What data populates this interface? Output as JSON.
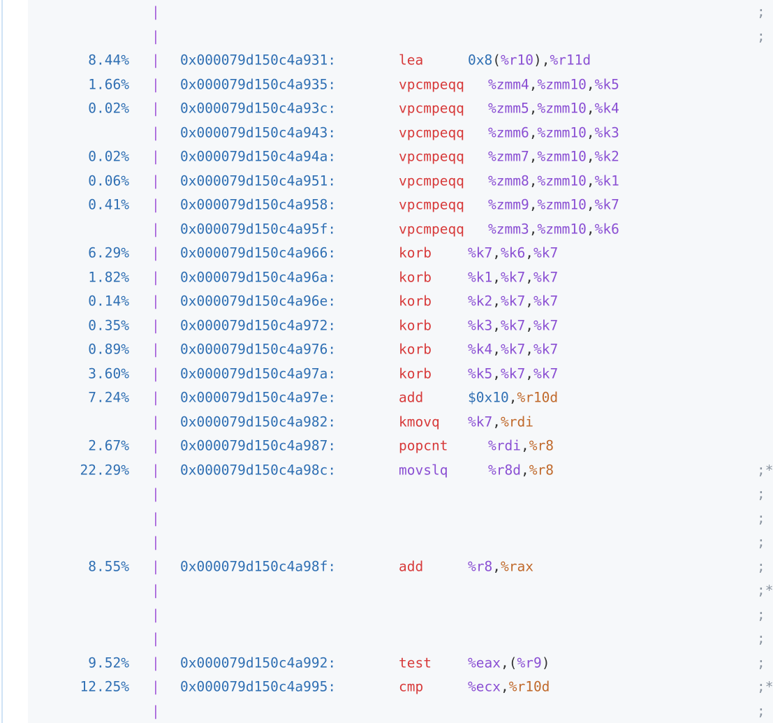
{
  "rows": [
    {
      "pct": "",
      "addr": "",
      "mnem": "",
      "ops": [],
      "semi": ";"
    },
    {
      "pct": "",
      "addr": "",
      "mnem": "",
      "ops": [],
      "semi": ";"
    },
    {
      "pct": "8.44%",
      "addr": "0x000079d150c4a931:",
      "mnem": "lea",
      "ops": [
        {
          "t": "0x8",
          "c": "num"
        },
        {
          "t": "(",
          "c": "punc"
        },
        {
          "t": "%r10",
          "c": "reg"
        },
        {
          "t": "),",
          "c": "punc"
        },
        {
          "t": "%r11d",
          "c": "reg"
        }
      ],
      "semi": ""
    },
    {
      "pct": "1.66%",
      "addr": "0x000079d150c4a935:",
      "mnem": "vpcmpeqq",
      "ops": [
        {
          "t": "%zmm4",
          "c": "reg"
        },
        {
          "t": ",",
          "c": "punc"
        },
        {
          "t": "%zmm10",
          "c": "reg"
        },
        {
          "t": ",",
          "c": "punc"
        },
        {
          "t": "%k5",
          "c": "reg"
        }
      ],
      "semi": ""
    },
    {
      "pct": "0.02%",
      "addr": "0x000079d150c4a93c:",
      "mnem": "vpcmpeqq",
      "ops": [
        {
          "t": "%zmm5",
          "c": "reg"
        },
        {
          "t": ",",
          "c": "punc"
        },
        {
          "t": "%zmm10",
          "c": "reg"
        },
        {
          "t": ",",
          "c": "punc"
        },
        {
          "t": "%k4",
          "c": "reg"
        }
      ],
      "semi": ""
    },
    {
      "pct": "",
      "addr": "0x000079d150c4a943:",
      "mnem": "vpcmpeqq",
      "ops": [
        {
          "t": "%zmm6",
          "c": "reg"
        },
        {
          "t": ",",
          "c": "punc"
        },
        {
          "t": "%zmm10",
          "c": "reg"
        },
        {
          "t": ",",
          "c": "punc"
        },
        {
          "t": "%k3",
          "c": "reg"
        }
      ],
      "semi": ""
    },
    {
      "pct": "0.02%",
      "addr": "0x000079d150c4a94a:",
      "mnem": "vpcmpeqq",
      "ops": [
        {
          "t": "%zmm7",
          "c": "reg"
        },
        {
          "t": ",",
          "c": "punc"
        },
        {
          "t": "%zmm10",
          "c": "reg"
        },
        {
          "t": ",",
          "c": "punc"
        },
        {
          "t": "%k2",
          "c": "reg"
        }
      ],
      "semi": ""
    },
    {
      "pct": "0.06%",
      "addr": "0x000079d150c4a951:",
      "mnem": "vpcmpeqq",
      "ops": [
        {
          "t": "%zmm8",
          "c": "reg"
        },
        {
          "t": ",",
          "c": "punc"
        },
        {
          "t": "%zmm10",
          "c": "reg"
        },
        {
          "t": ",",
          "c": "punc"
        },
        {
          "t": "%k1",
          "c": "reg"
        }
      ],
      "semi": ""
    },
    {
      "pct": "0.41%",
      "addr": "0x000079d150c4a958:",
      "mnem": "vpcmpeqq",
      "ops": [
        {
          "t": "%zmm9",
          "c": "reg"
        },
        {
          "t": ",",
          "c": "punc"
        },
        {
          "t": "%zmm10",
          "c": "reg"
        },
        {
          "t": ",",
          "c": "punc"
        },
        {
          "t": "%k7",
          "c": "reg"
        }
      ],
      "semi": ""
    },
    {
      "pct": "",
      "addr": "0x000079d150c4a95f:",
      "mnem": "vpcmpeqq",
      "ops": [
        {
          "t": "%zmm3",
          "c": "reg"
        },
        {
          "t": ",",
          "c": "punc"
        },
        {
          "t": "%zmm10",
          "c": "reg"
        },
        {
          "t": ",",
          "c": "punc"
        },
        {
          "t": "%k6",
          "c": "reg"
        }
      ],
      "semi": ""
    },
    {
      "pct": "6.29%",
      "addr": "0x000079d150c4a966:",
      "mnem": "korb",
      "ops": [
        {
          "t": "%k7",
          "c": "reg"
        },
        {
          "t": ",",
          "c": "punc"
        },
        {
          "t": "%k6",
          "c": "reg"
        },
        {
          "t": ",",
          "c": "punc"
        },
        {
          "t": "%k7",
          "c": "reg"
        }
      ],
      "semi": ""
    },
    {
      "pct": "1.82%",
      "addr": "0x000079d150c4a96a:",
      "mnem": "korb",
      "ops": [
        {
          "t": "%k1",
          "c": "reg"
        },
        {
          "t": ",",
          "c": "punc"
        },
        {
          "t": "%k7",
          "c": "reg"
        },
        {
          "t": ",",
          "c": "punc"
        },
        {
          "t": "%k7",
          "c": "reg"
        }
      ],
      "semi": ""
    },
    {
      "pct": "0.14%",
      "addr": "0x000079d150c4a96e:",
      "mnem": "korb",
      "ops": [
        {
          "t": "%k2",
          "c": "reg"
        },
        {
          "t": ",",
          "c": "punc"
        },
        {
          "t": "%k7",
          "c": "reg"
        },
        {
          "t": ",",
          "c": "punc"
        },
        {
          "t": "%k7",
          "c": "reg"
        }
      ],
      "semi": ""
    },
    {
      "pct": "0.35%",
      "addr": "0x000079d150c4a972:",
      "mnem": "korb",
      "ops": [
        {
          "t": "%k3",
          "c": "reg"
        },
        {
          "t": ",",
          "c": "punc"
        },
        {
          "t": "%k7",
          "c": "reg"
        },
        {
          "t": ",",
          "c": "punc"
        },
        {
          "t": "%k7",
          "c": "reg"
        }
      ],
      "semi": ""
    },
    {
      "pct": "0.89%",
      "addr": "0x000079d150c4a976:",
      "mnem": "korb",
      "ops": [
        {
          "t": "%k4",
          "c": "reg"
        },
        {
          "t": ",",
          "c": "punc"
        },
        {
          "t": "%k7",
          "c": "reg"
        },
        {
          "t": ",",
          "c": "punc"
        },
        {
          "t": "%k7",
          "c": "reg"
        }
      ],
      "semi": ""
    },
    {
      "pct": "3.60%",
      "addr": "0x000079d150c4a97a:",
      "mnem": "korb",
      "ops": [
        {
          "t": "%k5",
          "c": "reg"
        },
        {
          "t": ",",
          "c": "punc"
        },
        {
          "t": "%k7",
          "c": "reg"
        },
        {
          "t": ",",
          "c": "punc"
        },
        {
          "t": "%k7",
          "c": "reg"
        }
      ],
      "semi": ""
    },
    {
      "pct": "7.24%",
      "addr": "0x000079d150c4a97e:",
      "mnem": "add",
      "ops": [
        {
          "t": "$0x10",
          "c": "num"
        },
        {
          "t": ",",
          "c": "punc"
        },
        {
          "t": "%r10d",
          "c": "brn"
        }
      ],
      "semi": ""
    },
    {
      "pct": "",
      "addr": "0x000079d150c4a982:",
      "mnem": "kmovq",
      "ops": [
        {
          "t": "%k7",
          "c": "reg"
        },
        {
          "t": ",",
          "c": "punc"
        },
        {
          "t": "%rdi",
          "c": "brn"
        }
      ],
      "semi": ""
    },
    {
      "pct": "2.67%",
      "addr": "0x000079d150c4a987:",
      "mnem": "popcnt",
      "ops": [
        {
          "t": "%rdi",
          "c": "reg"
        },
        {
          "t": ",",
          "c": "punc"
        },
        {
          "t": "%r8",
          "c": "brn"
        }
      ],
      "semi": ""
    },
    {
      "pct": "22.29%",
      "addr": "0x000079d150c4a98c:",
      "mnem": "movslq",
      "ops": [
        {
          "t": "%r8d",
          "c": "reg"
        },
        {
          "t": ",",
          "c": "punc"
        },
        {
          "t": "%r8",
          "c": "brn"
        }
      ],
      "semi": ";*",
      "alt": true
    },
    {
      "pct": "",
      "addr": "",
      "mnem": "",
      "ops": [],
      "semi": ";"
    },
    {
      "pct": "",
      "addr": "",
      "mnem": "",
      "ops": [],
      "semi": ";"
    },
    {
      "pct": "",
      "addr": "",
      "mnem": "",
      "ops": [],
      "semi": ";"
    },
    {
      "pct": "8.55%",
      "addr": "0x000079d150c4a98f:",
      "mnem": "add",
      "ops": [
        {
          "t": "%r8",
          "c": "reg"
        },
        {
          "t": ",",
          "c": "punc"
        },
        {
          "t": "%rax",
          "c": "brn"
        }
      ],
      "semi": ";"
    },
    {
      "pct": "",
      "addr": "",
      "mnem": "",
      "ops": [],
      "semi": ";*"
    },
    {
      "pct": "",
      "addr": "",
      "mnem": "",
      "ops": [],
      "semi": ";"
    },
    {
      "pct": "",
      "addr": "",
      "mnem": "",
      "ops": [],
      "semi": ";"
    },
    {
      "pct": "9.52%",
      "addr": "0x000079d150c4a992:",
      "mnem": "test",
      "ops": [
        {
          "t": "%eax",
          "c": "reg"
        },
        {
          "t": ",",
          "c": "punc"
        },
        {
          "t": "(",
          "c": "punc"
        },
        {
          "t": "%r9",
          "c": "reg"
        },
        {
          "t": ")",
          "c": "punc"
        }
      ],
      "semi": ";"
    },
    {
      "pct": "12.25%",
      "addr": "0x000079d150c4a995:",
      "mnem": "cmp",
      "ops": [
        {
          "t": "%ecx",
          "c": "reg"
        },
        {
          "t": ",",
          "c": "punc"
        },
        {
          "t": "%r10d",
          "c": "brn"
        }
      ],
      "semi": ";*"
    },
    {
      "pct": "",
      "addr": "",
      "mnem": "",
      "ops": [],
      "semi": ";"
    }
  ],
  "pipe_char": "|",
  "colors": {
    "percent": "#2f6fb3",
    "address": "#2f6fb3",
    "mnemonic": "#d73a3a",
    "register": "#8a4fd3",
    "gutter_pipe": "#a259d9",
    "background": "#f6f8fa"
  }
}
